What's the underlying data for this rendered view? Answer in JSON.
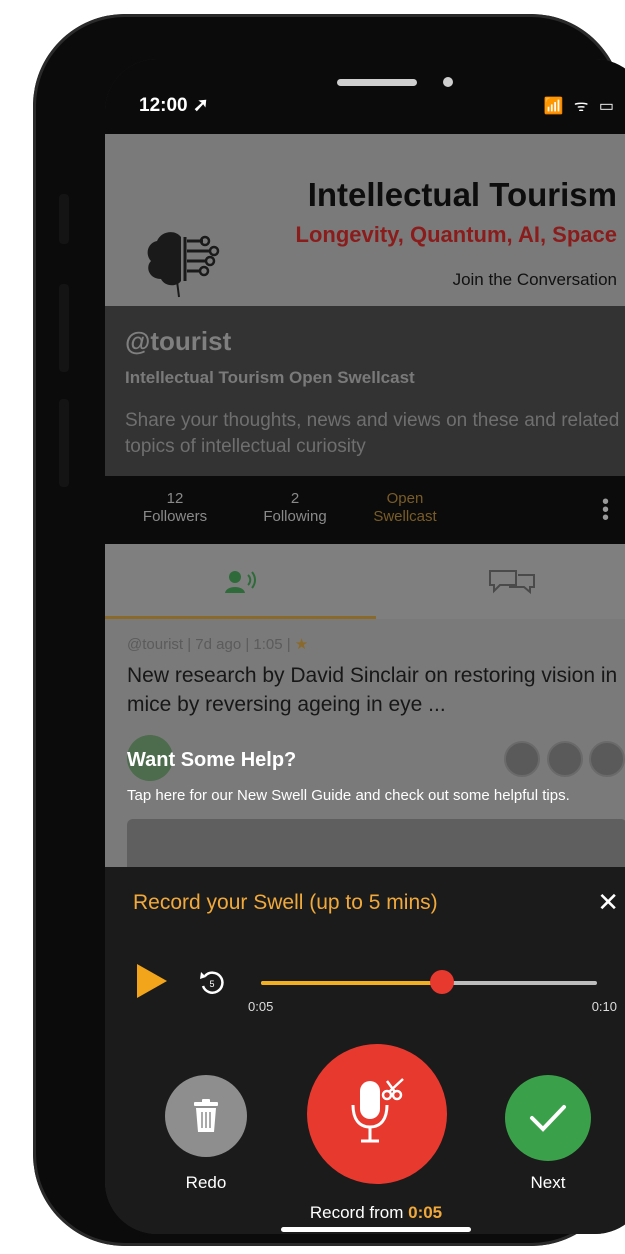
{
  "status": {
    "time": "12:00 ➚",
    "icons": "📶 ᯤ ▭"
  },
  "banner": {
    "title": "Intellectual Tourism",
    "subtitle": "Longevity, Quantum, AI, Space",
    "cta": "Join the Conversation"
  },
  "profile": {
    "handle": "@tourist",
    "name": "Intellectual Tourism Open Swellcast",
    "description": "Share your thoughts, news and views on these and related topics of intellectual curiosity"
  },
  "stats": {
    "followers_count": "12",
    "followers_label": "Followers",
    "following_count": "2",
    "following_label": "Following",
    "open_line1": "Open",
    "open_line2": "Swellcast"
  },
  "post": {
    "meta": "@tourist | 7d ago | 1:05 |",
    "title": "New research by David Sinclair on restoring vision in mice by reversing ageing in eye ..."
  },
  "help": {
    "title": "Want Some Help?",
    "body": "Tap here for our New Swell Guide and check out some helpful tips."
  },
  "recorder": {
    "title": "Record your Swell (up to 5 mins)",
    "close_label": "✕",
    "current_time": "0:05",
    "max_time": "0:10",
    "progress": 0.54,
    "redo_label": "Redo",
    "next_label": "Next",
    "record_from_prefix": "Record from",
    "record_from_time": "0:05"
  },
  "colors": {
    "accent": "#f0a93a",
    "record": "#e8392f",
    "next": "#3aa14a"
  }
}
